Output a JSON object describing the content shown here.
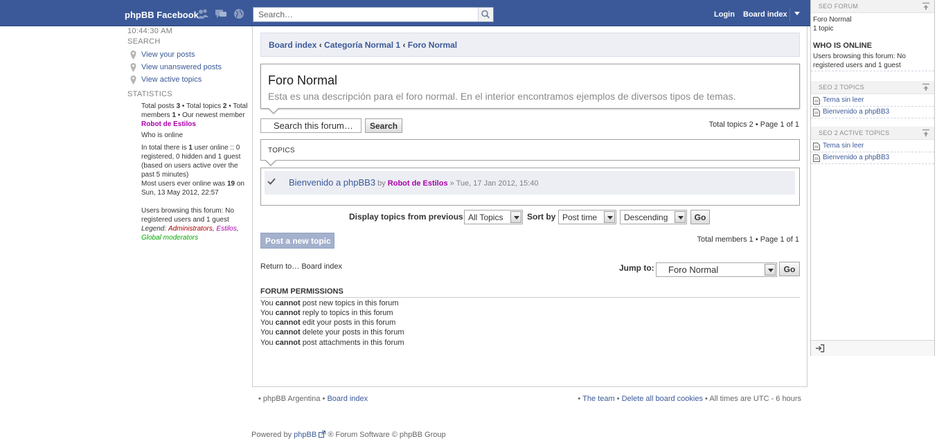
{
  "topbar": {
    "brand": "phpBB Facebook",
    "search_placeholder": "Search…",
    "login": "Login",
    "board_index": "Board index",
    "icons": [
      "friends-icon",
      "messages-icon",
      "globe-icon",
      "magnifier-icon",
      "dropdown-arrow-icon"
    ]
  },
  "left": {
    "clock": "10:44:30 AM",
    "search_heading": "SEARCH",
    "search_links": [
      "View your posts",
      "View unanswered posts",
      "View active topics"
    ],
    "stats_heading": "STATISTICS",
    "stats": {
      "total_posts_label": "Total posts",
      "total_posts": "3",
      "total_topics_label": "Total topics",
      "total_topics": "2",
      "total_members_label": "Total members",
      "total_members": "1",
      "newest_member_label": "Our newest member",
      "newest_member": "Robot de Estilos",
      "who_is_online": "Who is online",
      "online_prefix": "In total there is",
      "online_count": "1",
      "online_suffix": "user online :: 0 registered, 0 hidden and 1 guest (based on users active over the past 5 minutes)",
      "most_users_prefix": "Most users ever online was",
      "most_users_count": "19",
      "most_users_suffix": "on Sun, 13 May 2012, 22:57",
      "browsing": "Users browsing this forum: No registered users and 1 guest",
      "legend_label": "Legend:",
      "legend_admins": "Administrators",
      "legend_estilos": "Estilos",
      "legend_globalmods": "Global moderators"
    }
  },
  "main": {
    "breadcrumb": [
      "Board index",
      "Categoría Normal 1",
      "Foro Normal"
    ],
    "breadcrumb_sep": "‹",
    "forum_title": "Foro Normal",
    "forum_description": "Esta es una descripción para el foro normal. En el interior encontramos ejemplos de diversos tipos de temas.",
    "search_forum_value": "Search this forum…",
    "search_button": "Search",
    "pagination_top": "Total topics 2 • Page 1 of 1",
    "topics_label": "TOPICS",
    "topic": {
      "title": "Bienvenido a phpBB3",
      "by": "by",
      "author": "Robot de Estilos",
      "date": "» Tue, 17 Jan 2012, 15:40"
    },
    "sort": {
      "display_label": "Display topics from previous:",
      "display_value": "All Topics",
      "sort_by_label": "Sort by",
      "sort_by_value": "Post time",
      "order_value": "Descending",
      "go": "Go"
    },
    "post_new_topic": "Post a new topic",
    "pagination_bottom": "Total members 1 • Page 1 of 1",
    "return_prefix": "Return to…",
    "return_link": "Board index",
    "jump_label": "Jump to:",
    "jump_value": "Foro Normal",
    "jump_go": "Go",
    "permissions_title": "FORUM PERMISSIONS",
    "permissions": [
      {
        "pre": "You",
        "b": "cannot",
        "post": "post new topics in this forum"
      },
      {
        "pre": "You",
        "b": "cannot",
        "post": "reply to topics in this forum"
      },
      {
        "pre": "You",
        "b": "cannot",
        "post": "edit your posts in this forum"
      },
      {
        "pre": "You",
        "b": "cannot",
        "post": "delete your posts in this forum"
      },
      {
        "pre": "You",
        "b": "cannot",
        "post": "post attachments in this forum"
      }
    ]
  },
  "footer": {
    "left_site": "• phpBB Argentina •",
    "left_link": "Board index",
    "right_team": "The team",
    "right_cookies": "Delete all board cookies",
    "right_times": "• All times are UTC - 6 hours",
    "powered_prefix": "Powered by",
    "powered_link": "phpBB",
    "powered_suffix": "® Forum Software © phpBB Group"
  },
  "sidebar": {
    "seo_forum_heading": "SEO FORUM",
    "forum_name": "Foro Normal",
    "forum_topics": "1 topic",
    "who_online_heading": "WHO IS ONLINE",
    "who_online_text": "Users browsing this forum: No registered users and 1 guest",
    "seo_topics_heading": "SEO 2 TOPICS",
    "seo_topics": [
      "Tema sin leer",
      "Bienvenido a phpBB3"
    ],
    "seo_active_heading": "SEO 2 ACTIVE TOPICS",
    "seo_active": [
      "Tema sin leer",
      "Bienvenido a phpBB3"
    ]
  }
}
